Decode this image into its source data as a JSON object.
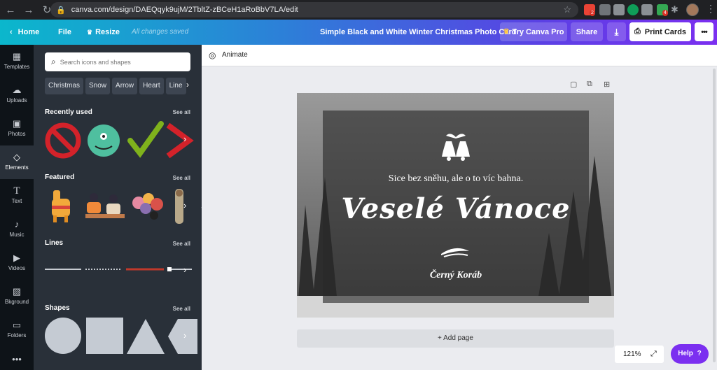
{
  "browser": {
    "url": "canva.com/design/DAEQqyk9ujM/2TbltZ-zBCeH1aRoBbV7LA/edit",
    "badge_mail": "2",
    "badge_ext": "4"
  },
  "topbar": {
    "home": "Home",
    "file": "File",
    "resize": "Resize",
    "saved_status": "All changes saved",
    "design_title": "Simple Black and White Winter Christmas Photo Card",
    "try_pro": "Try Canva Pro",
    "share": "Share",
    "print": "Print Cards",
    "more": "•••"
  },
  "sidebar": {
    "items": [
      {
        "label": "Templates"
      },
      {
        "label": "Uploads"
      },
      {
        "label": "Photos"
      },
      {
        "label": "Elements"
      },
      {
        "label": "Text"
      },
      {
        "label": "Music"
      },
      {
        "label": "Videos"
      },
      {
        "label": "Bkground"
      },
      {
        "label": "Folders"
      },
      {
        "label": "•••"
      }
    ]
  },
  "panel": {
    "search_placeholder": "Search icons and shapes",
    "chips": [
      "Christmas",
      "Snow",
      "Arrow",
      "Heart",
      "Line"
    ],
    "sections": {
      "recent": "Recently used",
      "featured": "Featured",
      "lines": "Lines",
      "shapes": "Shapes"
    },
    "see_all": "See all"
  },
  "editor": {
    "animate": "Animate",
    "add_page": "+ Add page",
    "zoom": "121%",
    "help": "Help",
    "help_q": "?"
  },
  "card": {
    "tagline": "Sice bez sněhu, ale o to víc bahna.",
    "greeting": "Veselé Vánoce",
    "signature": "Černý Koráb"
  },
  "colors": {
    "accent": "#7b2ff0",
    "panel": "#293039",
    "nav": "#0e1318"
  }
}
